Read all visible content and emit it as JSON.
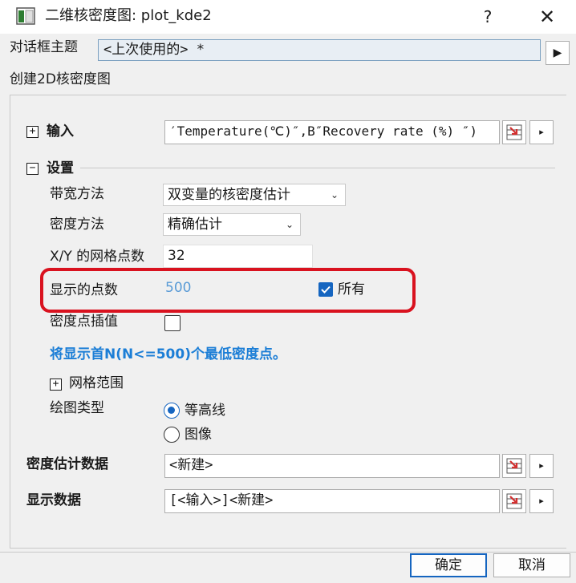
{
  "window": {
    "title": "二维核密度图: plot_kde2",
    "help_glyph": "?",
    "close_glyph": "✕"
  },
  "dialog_theme": {
    "label": "对话框主题",
    "value": "<上次使用的> *",
    "arrow_glyph": "▶"
  },
  "section_title": "创建2D核密度图",
  "input": {
    "expander": "+",
    "label": "输入",
    "value": "′Temperature(℃)″,B″Recovery rate (%) ″)",
    "arrow_glyph": "▸"
  },
  "settings": {
    "expander": "−",
    "label": "设置",
    "bandwidth": {
      "label": "带宽方法",
      "value": "双变量的核密度估计",
      "chevron": "⌄"
    },
    "density": {
      "label": "密度方法",
      "value": "精确估计",
      "chevron": "⌄"
    },
    "grid_points": {
      "label": "X/Y 的网格点数",
      "value": "32"
    },
    "display_points": {
      "label": "显示的点数",
      "value": "500",
      "all_label": "所有",
      "all_checked": true
    },
    "interpolate": {
      "label": "密度点插值",
      "checked": false
    },
    "note": "将显示首N(N<=500)个最低密度点。",
    "grid_range": {
      "expander": "+",
      "label": "网格范围"
    },
    "plot_type": {
      "label": "绘图类型",
      "options": [
        "等高线",
        "图像"
      ],
      "selected": 0
    }
  },
  "density_data": {
    "label": "密度估计数据",
    "value": "<新建>",
    "arrow_glyph": "▸"
  },
  "display_data": {
    "label": "显示数据",
    "value": "[<输入>]<新建>",
    "arrow_glyph": "▸"
  },
  "buttons": {
    "ok": "确定",
    "cancel": "取消"
  },
  "colors": {
    "accent": "#1565c0",
    "highlight": "#d9121f",
    "note": "#1c7ed6"
  }
}
